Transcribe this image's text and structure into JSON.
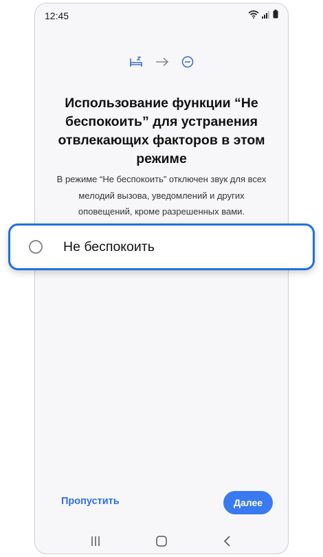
{
  "status_bar": {
    "time": "12:45",
    "icons": [
      "wifi-icon",
      "signal-icon",
      "battery-icon"
    ]
  },
  "flow": {
    "icons": [
      "bed-icon",
      "arrow-right-icon",
      "do-not-disturb-icon"
    ]
  },
  "content": {
    "title": "Использование функции “Не беспокоить” для устранения отвлекающих факторов в этом режиме",
    "description": "В режиме “Не беспокоить” отключен звук для всех мелодий вызова, уведомлений и других оповещений, кроме разрешенных вами."
  },
  "option": {
    "label": "Не беспокоить",
    "checked": false
  },
  "actions": {
    "skip_label": "Пропустить",
    "next_label": "Далее"
  },
  "nav_bar": {
    "buttons": [
      "recents-icon",
      "home-icon",
      "back-icon"
    ]
  },
  "colors": {
    "accent": "#3a7af0",
    "highlight_border": "#1f6fe0",
    "flow_icon": "#3b6fd1"
  }
}
